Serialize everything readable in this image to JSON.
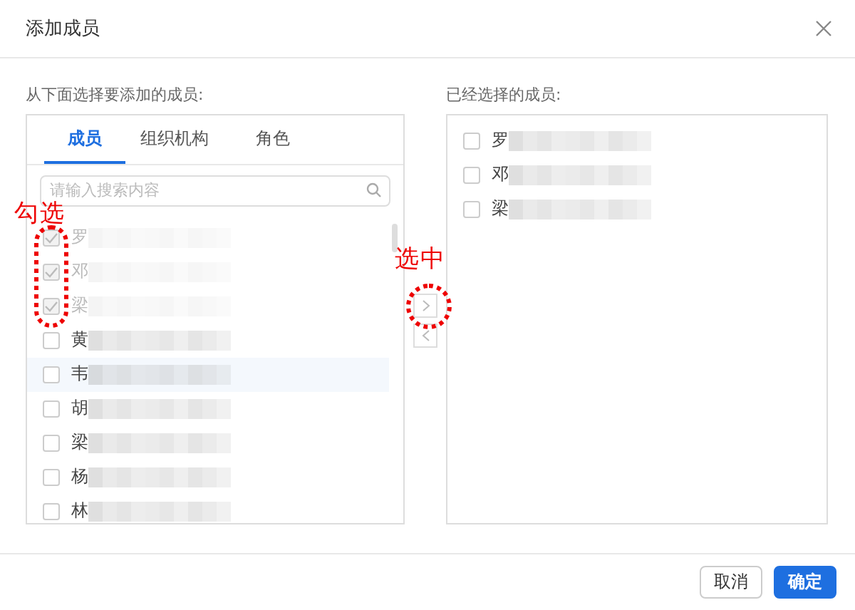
{
  "dialog": {
    "title": "添加成员"
  },
  "source": {
    "label": "从下面选择要添加的成员:",
    "tabs": [
      {
        "label": "成员",
        "selected": true
      },
      {
        "label": "组织机构",
        "selected": false
      },
      {
        "label": "角色",
        "selected": false
      }
    ],
    "search": {
      "placeholder": "请输入搜索内容"
    },
    "members": [
      {
        "name": "罗",
        "checked": true,
        "disabled": true,
        "hovered": false
      },
      {
        "name": "邓",
        "checked": true,
        "disabled": true,
        "hovered": false
      },
      {
        "name": "梁",
        "checked": true,
        "disabled": true,
        "hovered": false
      },
      {
        "name": "黄",
        "checked": false,
        "disabled": false,
        "hovered": false
      },
      {
        "name": "韦",
        "checked": false,
        "disabled": false,
        "hovered": true
      },
      {
        "name": "胡",
        "checked": false,
        "disabled": false,
        "hovered": false
      },
      {
        "name": "梁",
        "checked": false,
        "disabled": false,
        "hovered": false
      },
      {
        "name": "杨",
        "checked": false,
        "disabled": false,
        "hovered": false
      },
      {
        "name": "林",
        "checked": false,
        "disabled": false,
        "hovered": false
      }
    ]
  },
  "transfer": [
    {
      "kind": "right",
      "disabled": true
    },
    {
      "kind": "left",
      "disabled": true
    }
  ],
  "target": {
    "label": "已经选择的成员:",
    "members": [
      {
        "name": "罗",
        "checked": false
      },
      {
        "name": "邓",
        "checked": false
      },
      {
        "name": "梁",
        "checked": false
      }
    ]
  },
  "annotations": [
    {
      "text": "勾选",
      "kind": "checkboxes"
    },
    {
      "text": "选中",
      "kind": "transfer"
    }
  ],
  "buttons": [
    {
      "label": "取消",
      "kind": "default"
    },
    {
      "label": "确定",
      "kind": "primary"
    }
  ]
}
